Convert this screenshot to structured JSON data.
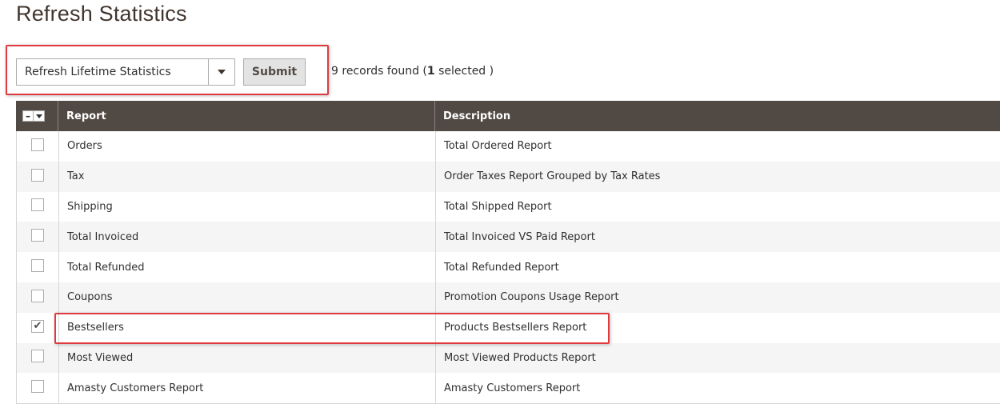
{
  "page": {
    "title": "Refresh Statistics"
  },
  "toolbar": {
    "action_value": "Refresh Lifetime Statistics",
    "submit_label": "Submit",
    "records_count": "9",
    "records_found_text": " records found (",
    "selected_count": "1",
    "selected_text": " selected )"
  },
  "grid": {
    "columns": {
      "report": "Report",
      "description": "Description"
    },
    "mass_minus": "–",
    "rows": [
      {
        "report": "Orders",
        "description": "Total Ordered Report",
        "checked": false
      },
      {
        "report": "Tax",
        "description": "Order Taxes Report Grouped by Tax Rates",
        "checked": false
      },
      {
        "report": "Shipping",
        "description": "Total Shipped Report",
        "checked": false
      },
      {
        "report": "Total Invoiced",
        "description": "Total Invoiced VS Paid Report",
        "checked": false
      },
      {
        "report": "Total Refunded",
        "description": "Total Refunded Report",
        "checked": false
      },
      {
        "report": "Coupons",
        "description": "Promotion Coupons Usage Report",
        "checked": false
      },
      {
        "report": "Bestsellers",
        "description": "Products Bestsellers Report",
        "checked": true
      },
      {
        "report": "Most Viewed",
        "description": "Most Viewed Products Report",
        "checked": false
      },
      {
        "report": "Amasty Customers Report",
        "description": "Amasty Customers Report",
        "checked": false
      }
    ]
  },
  "colors": {
    "header_bg": "#514943",
    "callout": "#e03a3e"
  },
  "icons": {
    "select_arrow": "chevron-down-icon",
    "check": "checkmark-icon"
  }
}
